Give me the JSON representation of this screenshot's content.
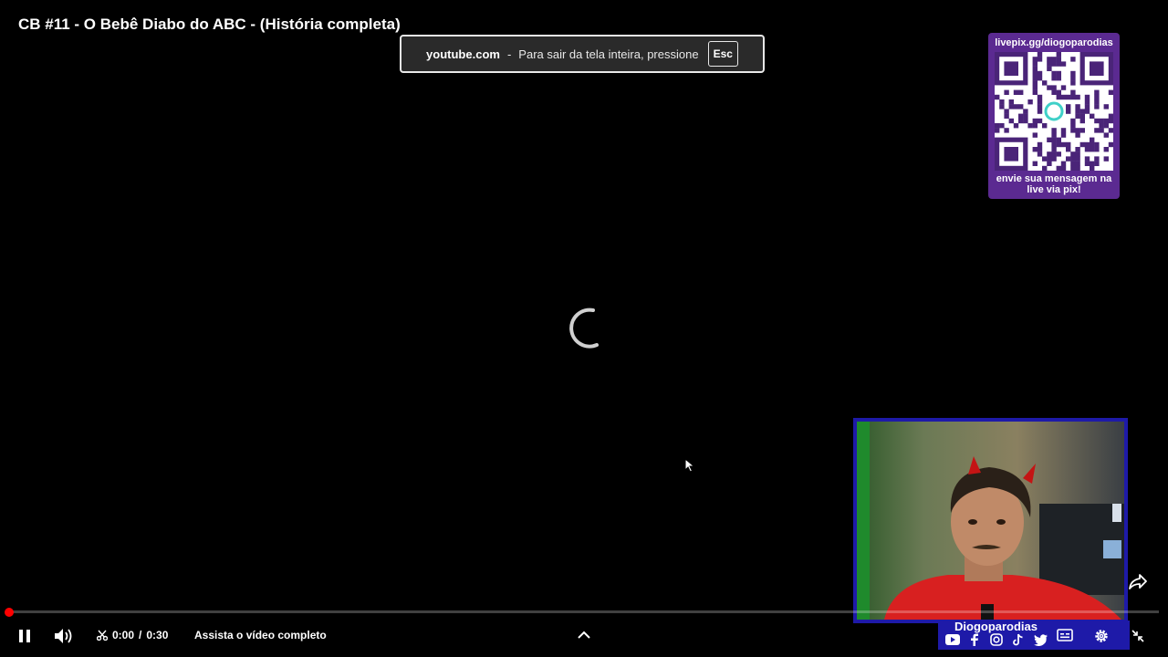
{
  "video": {
    "title": "CB #11 - O Bebê Diabo do ABC - (História completa)"
  },
  "fullscreen_notice": {
    "domain": "youtube.com",
    "separator": "-",
    "message": "Para sair da tela inteira, pressione",
    "key": "Esc"
  },
  "overlay_qr": {
    "url": "livepix.gg/diogoparodias",
    "message": "envie sua mensagem na live via pix!",
    "icon": "qr-code-icon"
  },
  "webcam": {
    "name": "Diogoparodias",
    "socials": [
      "youtube-icon",
      "facebook-icon",
      "instagram-icon",
      "tiktok-icon",
      "twitter-icon"
    ]
  },
  "player": {
    "state": "loading",
    "progress_fraction": 0.0,
    "time_current": "0:00",
    "time_separator": "/",
    "time_total": "0:30",
    "watch_full_label": "Assista o vídeo completo",
    "colors": {
      "progress": "#ff0000",
      "webcam_border": "#1e1aa8",
      "qr_card": "#5b2a91"
    }
  }
}
